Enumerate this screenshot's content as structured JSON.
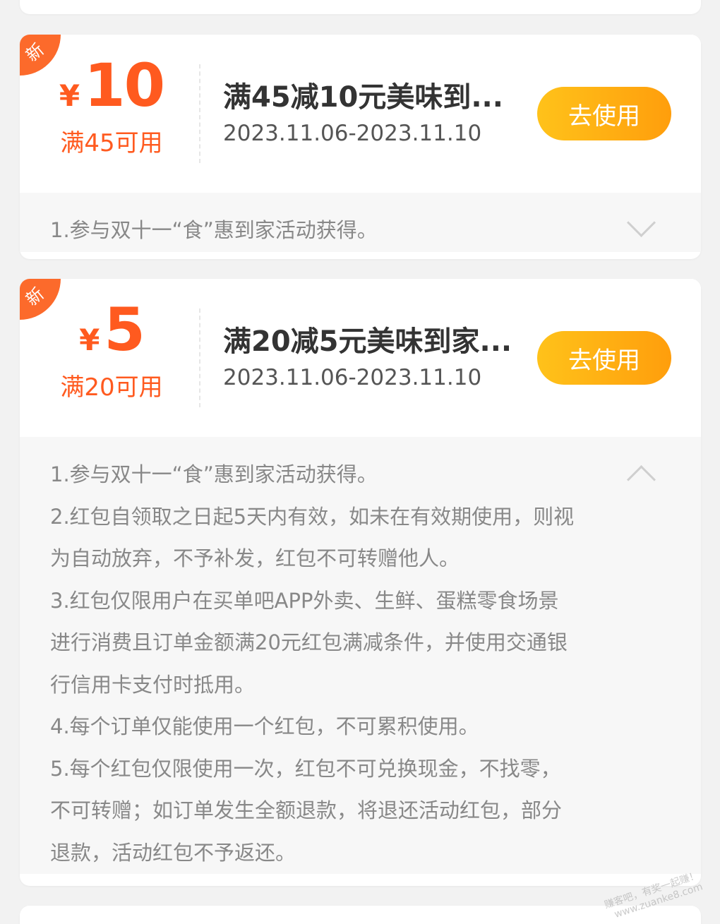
{
  "coupons": [
    {
      "badge": "新",
      "currency": "¥",
      "amount": "10",
      "min_use": "满45可用",
      "title": "满45减10元美味到...",
      "date_range": "2023.11.06-2023.11.10",
      "button_label": "去使用",
      "rules": [
        "1.参与双十一“食”惠到家活动获得。"
      ]
    },
    {
      "badge": "新",
      "currency": "¥",
      "amount": "5",
      "min_use": "满20可用",
      "title": "满20减5元美味到家...",
      "date_range": "2023.11.06-2023.11.10",
      "button_label": "去使用",
      "rules": [
        "1.参与双十一“食”惠到家活动获得。",
        "2.红包自领取之日起5天内有效，如未在有效期使用，则视",
        "为自动放弃，不予补发，红包不可转赠他人。",
        "3.红包仅限用户在买单吧APP外卖、生鲜、蛋糕零食场景",
        "进行消费且订单金额满20元红包满减条件，并使用交通银",
        "行信用卡支付时抵用。",
        "4.每个订单仅能使用一个红包，不可累积使用。",
        "5.每个红包仅限使用一次，红包不可兑换现金，不找零，",
        "不可转赠；如订单发生全额退款，将退还活动红包，部分",
        "退款，活动红包不予返还。"
      ]
    }
  ],
  "watermark": {
    "line1": "赚客吧，有奖一起赚！",
    "line2": "www.zuanke8.com"
  },
  "colors": {
    "accent": "#ff5a1f",
    "badge": "#fc6a2b",
    "button_start": "#ffc21a",
    "button_end": "#ff9e0c"
  }
}
